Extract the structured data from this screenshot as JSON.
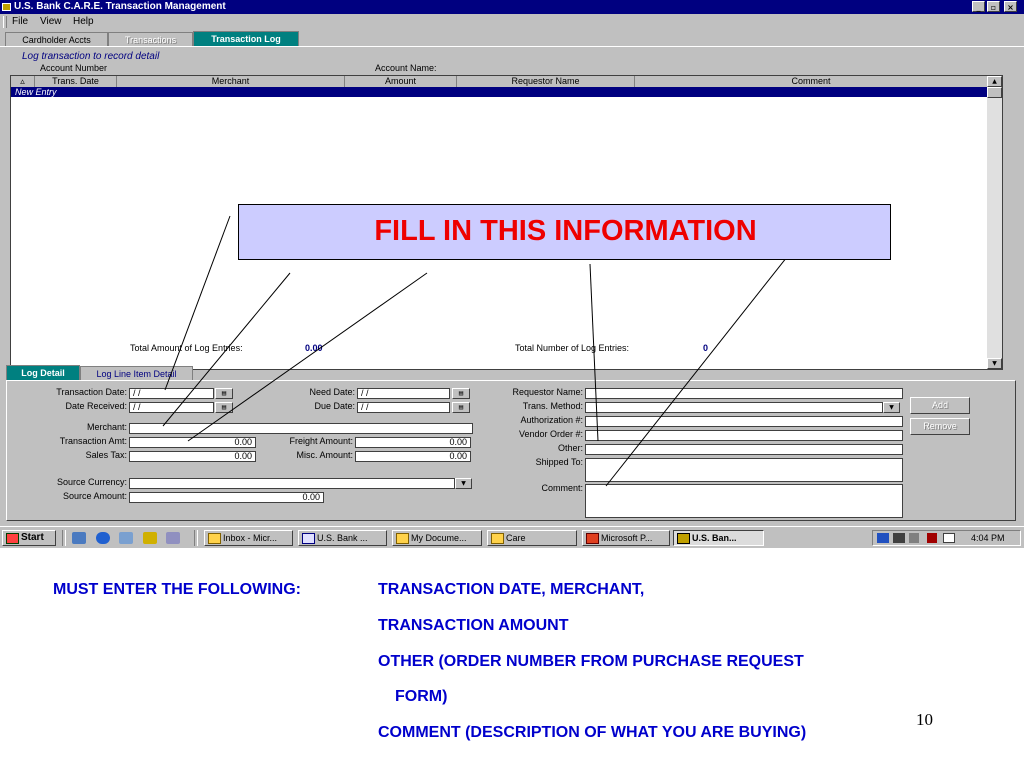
{
  "window": {
    "title": "U.S. Bank C.A.R.E. Transaction Management",
    "controls": [
      "_",
      "▫",
      "×"
    ]
  },
  "menu": [
    "File",
    "View",
    "Help"
  ],
  "main_tabs": [
    {
      "label": "Cardholder Accts",
      "state": "normal"
    },
    {
      "label": "Transactions",
      "state": "disabled"
    },
    {
      "label": "Transaction Log",
      "state": "active"
    }
  ],
  "log_header": {
    "title": "Log transaction to record detail",
    "account_number_label": "Account Number",
    "account_name_label": "Account Name:"
  },
  "grid": {
    "columns": [
      "Trans. Date",
      "Merchant",
      "Amount",
      "Requestor Name",
      "Comment"
    ],
    "rows": [
      "New Entry"
    ]
  },
  "totals": {
    "amount_label": "Total Amount of Log Entries:",
    "amount_value": "0.00",
    "count_label": "Total Number of Log Entries:",
    "count_value": "0"
  },
  "detail_tabs": [
    {
      "label": "Log Detail",
      "state": "active"
    },
    {
      "label": "Log Line Item Detail",
      "state": "normal"
    }
  ],
  "form": {
    "transaction_date": {
      "label": "Transaction Date:",
      "value": " /  /"
    },
    "date_received": {
      "label": "Date Received:",
      "value": " /  /"
    },
    "merchant": {
      "label": "Merchant:",
      "value": ""
    },
    "transaction_amt": {
      "label": "Transaction Amt:",
      "value": "0.00"
    },
    "sales_tax": {
      "label": "Sales Tax:",
      "value": "0.00"
    },
    "need_date": {
      "label": "Need Date:",
      "value": " /  /"
    },
    "due_date": {
      "label": "Due Date:",
      "value": " /  /"
    },
    "freight_amount": {
      "label": "Freight Amount:",
      "value": "0.00"
    },
    "misc_amount": {
      "label": "Misc. Amount:",
      "value": "0.00"
    },
    "source_currency": {
      "label": "Source Currency:",
      "value": ""
    },
    "source_amount": {
      "label": "Source Amount:",
      "value": "0.00"
    },
    "requestor_name": {
      "label": "Requestor Name:",
      "value": ""
    },
    "trans_method": {
      "label": "Trans. Method:",
      "value": ""
    },
    "authorization": {
      "label": "Authorization #:",
      "value": ""
    },
    "vendor_order": {
      "label": "Vendor Order #:",
      "value": ""
    },
    "other": {
      "label": "Other:",
      "value": ""
    },
    "shipped_to": {
      "label": "Shipped To:",
      "value": ""
    },
    "comment": {
      "label": "Comment:",
      "value": ""
    },
    "add_label": "Add",
    "remove_label": "Remove"
  },
  "callout": {
    "text": "FILL IN THIS INFORMATION",
    "color": "#ee0000",
    "bg": "#ccccff"
  },
  "taskbar": {
    "start": "Start",
    "tasks": [
      "Inbox - Micr...",
      "U.S. Bank ...",
      "My Docume...",
      "Care",
      "Microsoft P...",
      "U.S. Ban..."
    ],
    "clock": "4:04 PM"
  },
  "notes": {
    "heading": "MUST ENTER THE FOLLOWING:",
    "lines": [
      "TRANSACTION DATE,  MERCHANT,",
      "TRANSACTION AMOUNT",
      "OTHER  (ORDER NUMBER FROM PURCHASE REQUEST",
      "FORM)",
      "COMMENT (DESCRIPTION OF WHAT YOU ARE BUYING)"
    ],
    "color": "#0000cc"
  },
  "page_number": "10"
}
